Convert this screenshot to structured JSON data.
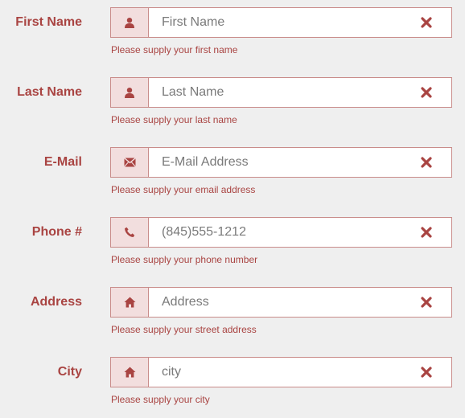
{
  "theme": {
    "error_color": "#a94442",
    "addon_background": "#f2dede",
    "border_color": "#c98c8a",
    "page_background": "#efefef"
  },
  "fields": [
    {
      "label": "First Name",
      "icon": "user-icon",
      "value": "",
      "placeholder": "First Name",
      "help": "Please supply your first name",
      "status_icon": "remove-icon"
    },
    {
      "label": "Last Name",
      "icon": "user-icon",
      "value": "",
      "placeholder": "Last Name",
      "help": "Please supply your last name",
      "status_icon": "remove-icon"
    },
    {
      "label": "E-Mail",
      "icon": "envelope-icon",
      "value": "",
      "placeholder": "E-Mail Address",
      "help": "Please supply your email address",
      "status_icon": "remove-icon"
    },
    {
      "label": "Phone #",
      "icon": "phone-icon",
      "value": "",
      "placeholder": "(845)555-1212",
      "help": "Please supply your phone number",
      "status_icon": "remove-icon"
    },
    {
      "label": "Address",
      "icon": "home-icon",
      "value": "",
      "placeholder": "Address",
      "help": "Please supply your street address",
      "status_icon": "remove-icon"
    },
    {
      "label": "City",
      "icon": "home-icon",
      "value": "",
      "placeholder": "city",
      "help": "Please supply your city",
      "status_icon": "remove-icon"
    }
  ]
}
